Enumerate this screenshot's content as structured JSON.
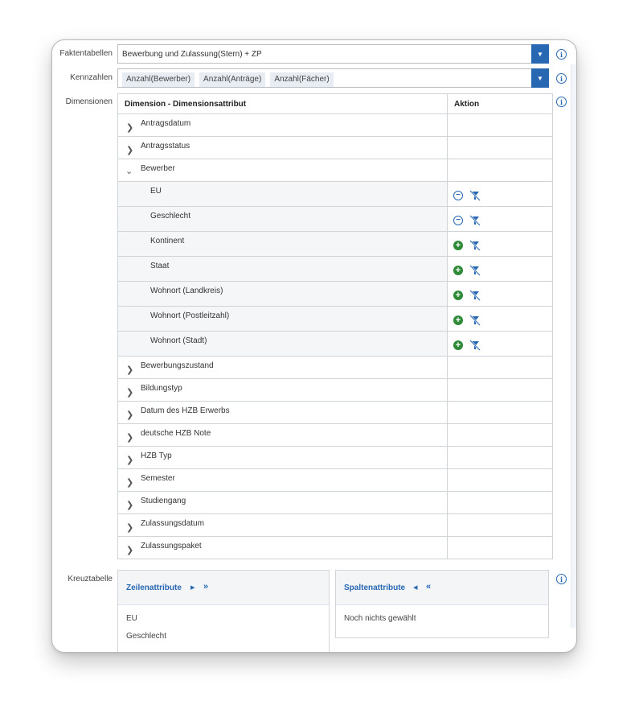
{
  "labels": {
    "fact_tables": "Faktentabellen",
    "key_figures": "Kennzahlen",
    "dimensions": "Dimensionen",
    "crosstab": "Kreuztabelle"
  },
  "fact_table": {
    "value": "Bewerbung und Zulassung(Stern) + ZP"
  },
  "key_figures": {
    "chips": [
      "Anzahl(Bewerber)",
      "Anzahl(Anträge)",
      "Anzahl(Fächer)"
    ]
  },
  "dimension_table": {
    "col_dimension": "Dimension - Dimensionsattribut",
    "col_action": "Aktion",
    "groups_before": [
      {
        "label": "Antragsdatum"
      },
      {
        "label": "Antragsstatus"
      }
    ],
    "expanded_group": {
      "label": "Bewerber"
    },
    "attributes": [
      {
        "label": "EU",
        "action": "remove"
      },
      {
        "label": "Geschlecht",
        "action": "remove"
      },
      {
        "label": "Kontinent",
        "action": "add"
      },
      {
        "label": "Staat",
        "action": "add"
      },
      {
        "label": "Wohnort (Landkreis)",
        "action": "add"
      },
      {
        "label": "Wohnort (Postleitzahl)",
        "action": "add"
      },
      {
        "label": "Wohnort (Stadt)",
        "action": "add"
      }
    ],
    "groups_after": [
      {
        "label": "Bewerbungszustand"
      },
      {
        "label": "Bildungstyp"
      },
      {
        "label": "Datum des HZB Erwerbs"
      },
      {
        "label": "deutsche HZB Note"
      },
      {
        "label": "HZB Typ"
      },
      {
        "label": "Semester"
      },
      {
        "label": "Studiengang"
      },
      {
        "label": "Zulassungsdatum"
      },
      {
        "label": "Zulassungspaket"
      }
    ]
  },
  "row_attributes": {
    "title": "Zeilenattribute",
    "items": [
      "EU",
      "Geschlecht"
    ]
  },
  "column_attributes": {
    "title": "Spaltenattribute",
    "empty_text": "Noch nichts gewählt"
  },
  "colors": {
    "accent": "#2868b3",
    "add_green": "#2f8a38"
  },
  "icons": {
    "dropdown": "chevron-down-icon",
    "info": "info-icon",
    "collapsed": "chevron-right-icon",
    "expanded": "chevron-down-icon",
    "remove": "minus-circle-icon",
    "add": "plus-circle-icon",
    "filter": "filter-remove-icon"
  }
}
